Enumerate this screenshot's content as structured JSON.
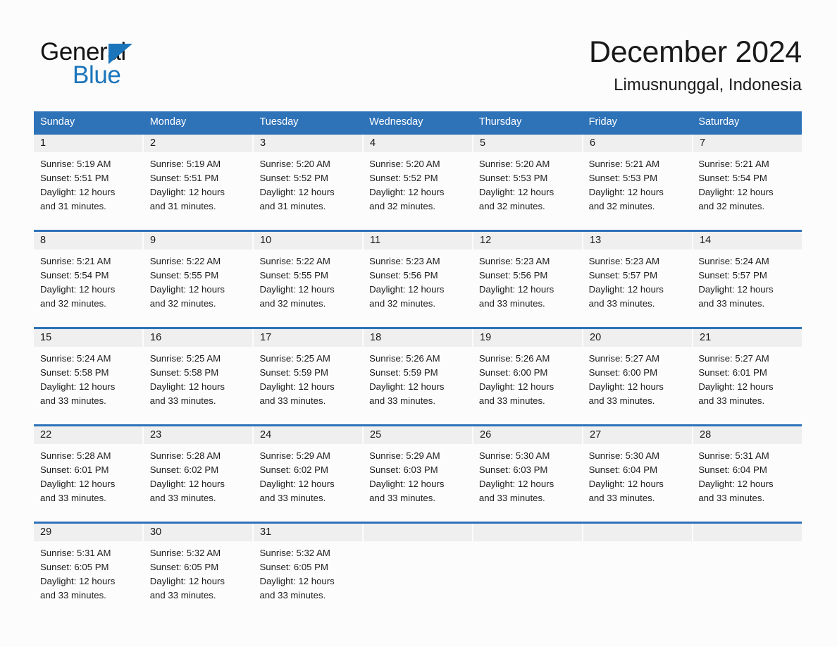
{
  "brand": {
    "name_top": "General",
    "name_bottom": "Blue",
    "color_blue": "#1b75bb",
    "triangle_icon": "triangle-icon"
  },
  "header": {
    "title": "December 2024",
    "subtitle": "Limusnunggal, Indonesia"
  },
  "colors": {
    "header_bar": "#2e72b8",
    "row_divider": "#2e72b8",
    "daynum_band": "#efefef",
    "page_background": "#fcfcfc",
    "text": "#1a1a1a"
  },
  "weekdays": [
    "Sunday",
    "Monday",
    "Tuesday",
    "Wednesday",
    "Thursday",
    "Friday",
    "Saturday"
  ],
  "weeks": [
    [
      {
        "day": "1",
        "sunrise": "Sunrise: 5:19 AM",
        "sunset": "Sunset: 5:51 PM",
        "daylight1": "Daylight: 12 hours",
        "daylight2": "and 31 minutes."
      },
      {
        "day": "2",
        "sunrise": "Sunrise: 5:19 AM",
        "sunset": "Sunset: 5:51 PM",
        "daylight1": "Daylight: 12 hours",
        "daylight2": "and 31 minutes."
      },
      {
        "day": "3",
        "sunrise": "Sunrise: 5:20 AM",
        "sunset": "Sunset: 5:52 PM",
        "daylight1": "Daylight: 12 hours",
        "daylight2": "and 31 minutes."
      },
      {
        "day": "4",
        "sunrise": "Sunrise: 5:20 AM",
        "sunset": "Sunset: 5:52 PM",
        "daylight1": "Daylight: 12 hours",
        "daylight2": "and 32 minutes."
      },
      {
        "day": "5",
        "sunrise": "Sunrise: 5:20 AM",
        "sunset": "Sunset: 5:53 PM",
        "daylight1": "Daylight: 12 hours",
        "daylight2": "and 32 minutes."
      },
      {
        "day": "6",
        "sunrise": "Sunrise: 5:21 AM",
        "sunset": "Sunset: 5:53 PM",
        "daylight1": "Daylight: 12 hours",
        "daylight2": "and 32 minutes."
      },
      {
        "day": "7",
        "sunrise": "Sunrise: 5:21 AM",
        "sunset": "Sunset: 5:54 PM",
        "daylight1": "Daylight: 12 hours",
        "daylight2": "and 32 minutes."
      }
    ],
    [
      {
        "day": "8",
        "sunrise": "Sunrise: 5:21 AM",
        "sunset": "Sunset: 5:54 PM",
        "daylight1": "Daylight: 12 hours",
        "daylight2": "and 32 minutes."
      },
      {
        "day": "9",
        "sunrise": "Sunrise: 5:22 AM",
        "sunset": "Sunset: 5:55 PM",
        "daylight1": "Daylight: 12 hours",
        "daylight2": "and 32 minutes."
      },
      {
        "day": "10",
        "sunrise": "Sunrise: 5:22 AM",
        "sunset": "Sunset: 5:55 PM",
        "daylight1": "Daylight: 12 hours",
        "daylight2": "and 32 minutes."
      },
      {
        "day": "11",
        "sunrise": "Sunrise: 5:23 AM",
        "sunset": "Sunset: 5:56 PM",
        "daylight1": "Daylight: 12 hours",
        "daylight2": "and 32 minutes."
      },
      {
        "day": "12",
        "sunrise": "Sunrise: 5:23 AM",
        "sunset": "Sunset: 5:56 PM",
        "daylight1": "Daylight: 12 hours",
        "daylight2": "and 33 minutes."
      },
      {
        "day": "13",
        "sunrise": "Sunrise: 5:23 AM",
        "sunset": "Sunset: 5:57 PM",
        "daylight1": "Daylight: 12 hours",
        "daylight2": "and 33 minutes."
      },
      {
        "day": "14",
        "sunrise": "Sunrise: 5:24 AM",
        "sunset": "Sunset: 5:57 PM",
        "daylight1": "Daylight: 12 hours",
        "daylight2": "and 33 minutes."
      }
    ],
    [
      {
        "day": "15",
        "sunrise": "Sunrise: 5:24 AM",
        "sunset": "Sunset: 5:58 PM",
        "daylight1": "Daylight: 12 hours",
        "daylight2": "and 33 minutes."
      },
      {
        "day": "16",
        "sunrise": "Sunrise: 5:25 AM",
        "sunset": "Sunset: 5:58 PM",
        "daylight1": "Daylight: 12 hours",
        "daylight2": "and 33 minutes."
      },
      {
        "day": "17",
        "sunrise": "Sunrise: 5:25 AM",
        "sunset": "Sunset: 5:59 PM",
        "daylight1": "Daylight: 12 hours",
        "daylight2": "and 33 minutes."
      },
      {
        "day": "18",
        "sunrise": "Sunrise: 5:26 AM",
        "sunset": "Sunset: 5:59 PM",
        "daylight1": "Daylight: 12 hours",
        "daylight2": "and 33 minutes."
      },
      {
        "day": "19",
        "sunrise": "Sunrise: 5:26 AM",
        "sunset": "Sunset: 6:00 PM",
        "daylight1": "Daylight: 12 hours",
        "daylight2": "and 33 minutes."
      },
      {
        "day": "20",
        "sunrise": "Sunrise: 5:27 AM",
        "sunset": "Sunset: 6:00 PM",
        "daylight1": "Daylight: 12 hours",
        "daylight2": "and 33 minutes."
      },
      {
        "day": "21",
        "sunrise": "Sunrise: 5:27 AM",
        "sunset": "Sunset: 6:01 PM",
        "daylight1": "Daylight: 12 hours",
        "daylight2": "and 33 minutes."
      }
    ],
    [
      {
        "day": "22",
        "sunrise": "Sunrise: 5:28 AM",
        "sunset": "Sunset: 6:01 PM",
        "daylight1": "Daylight: 12 hours",
        "daylight2": "and 33 minutes."
      },
      {
        "day": "23",
        "sunrise": "Sunrise: 5:28 AM",
        "sunset": "Sunset: 6:02 PM",
        "daylight1": "Daylight: 12 hours",
        "daylight2": "and 33 minutes."
      },
      {
        "day": "24",
        "sunrise": "Sunrise: 5:29 AM",
        "sunset": "Sunset: 6:02 PM",
        "daylight1": "Daylight: 12 hours",
        "daylight2": "and 33 minutes."
      },
      {
        "day": "25",
        "sunrise": "Sunrise: 5:29 AM",
        "sunset": "Sunset: 6:03 PM",
        "daylight1": "Daylight: 12 hours",
        "daylight2": "and 33 minutes."
      },
      {
        "day": "26",
        "sunrise": "Sunrise: 5:30 AM",
        "sunset": "Sunset: 6:03 PM",
        "daylight1": "Daylight: 12 hours",
        "daylight2": "and 33 minutes."
      },
      {
        "day": "27",
        "sunrise": "Sunrise: 5:30 AM",
        "sunset": "Sunset: 6:04 PM",
        "daylight1": "Daylight: 12 hours",
        "daylight2": "and 33 minutes."
      },
      {
        "day": "28",
        "sunrise": "Sunrise: 5:31 AM",
        "sunset": "Sunset: 6:04 PM",
        "daylight1": "Daylight: 12 hours",
        "daylight2": "and 33 minutes."
      }
    ],
    [
      {
        "day": "29",
        "sunrise": "Sunrise: 5:31 AM",
        "sunset": "Sunset: 6:05 PM",
        "daylight1": "Daylight: 12 hours",
        "daylight2": "and 33 minutes."
      },
      {
        "day": "30",
        "sunrise": "Sunrise: 5:32 AM",
        "sunset": "Sunset: 6:05 PM",
        "daylight1": "Daylight: 12 hours",
        "daylight2": "and 33 minutes."
      },
      {
        "day": "31",
        "sunrise": "Sunrise: 5:32 AM",
        "sunset": "Sunset: 6:05 PM",
        "daylight1": "Daylight: 12 hours",
        "daylight2": "and 33 minutes."
      },
      {
        "day": "",
        "sunrise": "",
        "sunset": "",
        "daylight1": "",
        "daylight2": ""
      },
      {
        "day": "",
        "sunrise": "",
        "sunset": "",
        "daylight1": "",
        "daylight2": ""
      },
      {
        "day": "",
        "sunrise": "",
        "sunset": "",
        "daylight1": "",
        "daylight2": ""
      },
      {
        "day": "",
        "sunrise": "",
        "sunset": "",
        "daylight1": "",
        "daylight2": ""
      }
    ]
  ]
}
